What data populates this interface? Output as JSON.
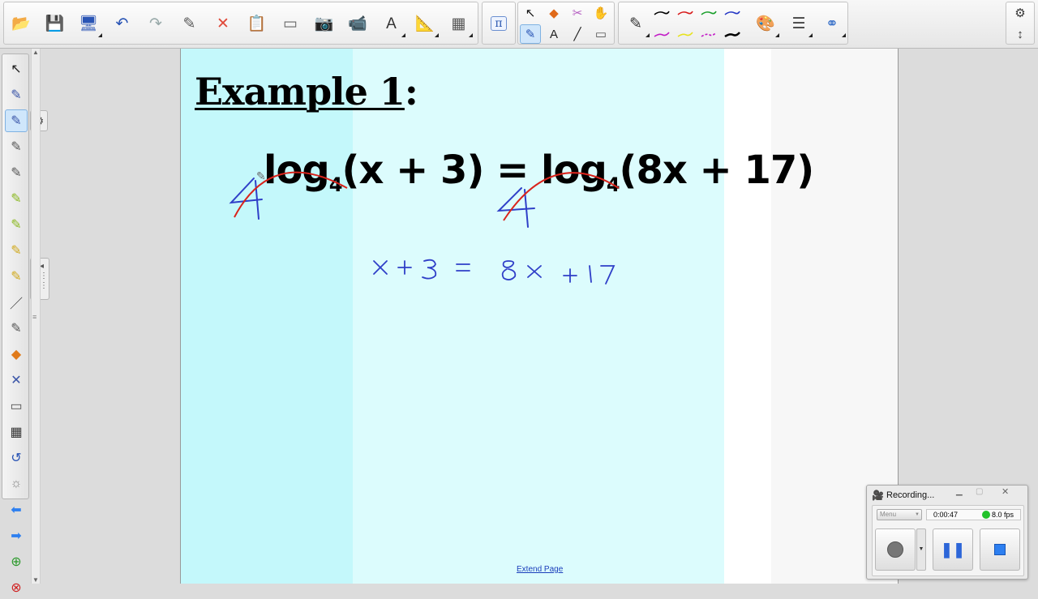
{
  "toolbar": {
    "left_group": [
      {
        "name": "open-file-icon",
        "glyph": "📂"
      },
      {
        "name": "save-icon",
        "glyph": "💾"
      },
      {
        "name": "view-screens-icon",
        "glyph": "🖥"
      },
      {
        "name": "undo-icon",
        "glyph": "↶"
      },
      {
        "name": "redo-icon",
        "glyph": "↷"
      },
      {
        "name": "clear-ink-icon",
        "glyph": "✎"
      },
      {
        "name": "delete-icon",
        "glyph": "✕"
      },
      {
        "name": "paste-icon",
        "glyph": "📋"
      },
      {
        "name": "screen-shade-icon",
        "glyph": "▭"
      },
      {
        "name": "capture-icon",
        "glyph": "📷"
      },
      {
        "name": "document-camera-icon",
        "glyph": "📹"
      },
      {
        "name": "insert-text-icon",
        "glyph": "A"
      },
      {
        "name": "measurement-tools-icon",
        "glyph": "📐"
      },
      {
        "name": "table-icon",
        "glyph": "▦"
      }
    ],
    "math_button": "π",
    "tools_top": [
      "↖",
      "◆",
      "✂",
      "✋"
    ],
    "tools_bottom": [
      "✎",
      "A",
      "╱",
      "▭"
    ],
    "pen_styles_top": [
      "#000000",
      "#d81b1b",
      "#1a9f2b",
      "#2436c4"
    ],
    "pen_styles_bottom": [
      "#c21ac6",
      "#e7e21c",
      "#c21ac6",
      "#000000"
    ],
    "right_tools": [
      "🎨",
      "☰",
      "⚭"
    ],
    "settings_icon": "⚙",
    "move_icon": "↕"
  },
  "left_tools": [
    "↖",
    "✎",
    "✎",
    "✎",
    "✎",
    "✎",
    "✎",
    "✎",
    "✎",
    "／",
    "✎",
    "◆",
    "✕",
    "▭",
    "▦",
    "↺",
    "☼",
    "⬅",
    "➡",
    "⊕",
    "⊗"
  ],
  "page": {
    "title": "Example 1",
    "title_colon": ":",
    "equation_left_log": "log",
    "equation_left_base": "4",
    "equation_left_arg": "(x + 3)",
    "equation_eq": "=",
    "equation_right_log": "log",
    "equation_right_base": "4",
    "equation_right_arg": "(8x + 17)",
    "handwritten": "x + 3 = 8x + 17",
    "extend_link": "Extend Page"
  },
  "colors": {
    "band_cyan": "#c7fafc",
    "band_light": "#ddfdfd",
    "ink_blue": "#2f3fc8",
    "ink_red": "#d9241c",
    "accent": "#2f6fd6"
  },
  "recorder": {
    "title": "Recording...",
    "menu_label": "Menu",
    "elapsed": "0:00:47",
    "fps": "8.0 fps"
  }
}
